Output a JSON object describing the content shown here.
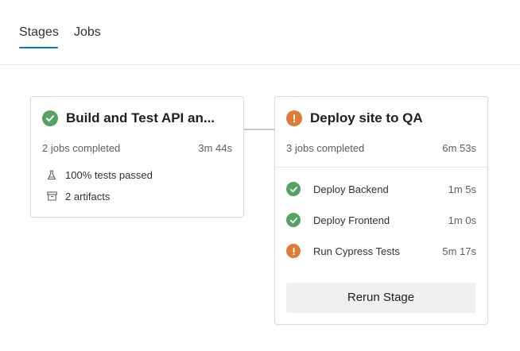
{
  "tabs": [
    {
      "label": "Stages",
      "active": true
    },
    {
      "label": "Jobs",
      "active": false
    }
  ],
  "colors": {
    "accent": "#0078d4",
    "success": "#55a362",
    "warning": "#e07b39"
  },
  "stages": [
    {
      "title": "Build and Test API an...",
      "status": "success",
      "status_icon": "check-circle-icon",
      "jobs_completed": "2 jobs completed",
      "duration": "3m 44s",
      "tests": {
        "icon": "flask-icon",
        "text": "100% tests passed"
      },
      "artifacts": {
        "icon": "archive-icon",
        "text": "2 artifacts"
      }
    },
    {
      "title": "Deploy site to QA",
      "status": "warning",
      "status_icon": "warning-circle-icon",
      "jobs_completed": "3 jobs completed",
      "duration": "6m 53s",
      "jobs": [
        {
          "name": "Deploy Backend",
          "duration": "1m 5s",
          "status": "success",
          "icon": "check-circle-icon"
        },
        {
          "name": "Deploy Frontend",
          "duration": "1m 0s",
          "status": "success",
          "icon": "check-circle-icon"
        },
        {
          "name": "Run Cypress Tests",
          "duration": "5m 17s",
          "status": "warning",
          "icon": "warning-circle-icon"
        }
      ],
      "rerun_label": "Rerun Stage"
    }
  ]
}
